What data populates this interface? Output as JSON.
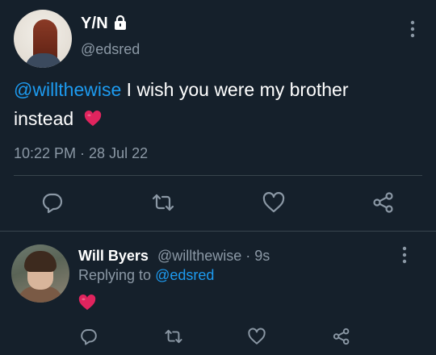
{
  "main_tweet": {
    "display_name": "Y/N",
    "handle": "@edsred",
    "mention": "@willthewise",
    "text_line1": " I wish you were my brother",
    "text_line2": "instead",
    "emoji": "red-heart",
    "timestamp": "10:22 PM · 28 Jul 22",
    "icons": {
      "lock": "lock-icon",
      "more": "more-vertical-icon",
      "reply": "reply-icon",
      "retweet": "retweet-icon",
      "like": "like-icon",
      "share": "share-icon"
    }
  },
  "reply_tweet": {
    "display_name": "Will Byers",
    "meta": "@willthewise · 9s",
    "replying_label": "Replying to ",
    "replying_handle": "@edsred",
    "emoji": "red-heart",
    "icons": {
      "more": "more-vertical-icon",
      "reply": "reply-icon",
      "retweet": "retweet-icon",
      "like": "like-icon",
      "share": "share-icon"
    }
  },
  "colors": {
    "background": "#15202b",
    "text": "#ffffff",
    "secondary_text": "#8b98a5",
    "link": "#1d9bf0",
    "divider": "#38444d",
    "heart": "#e0245e"
  }
}
